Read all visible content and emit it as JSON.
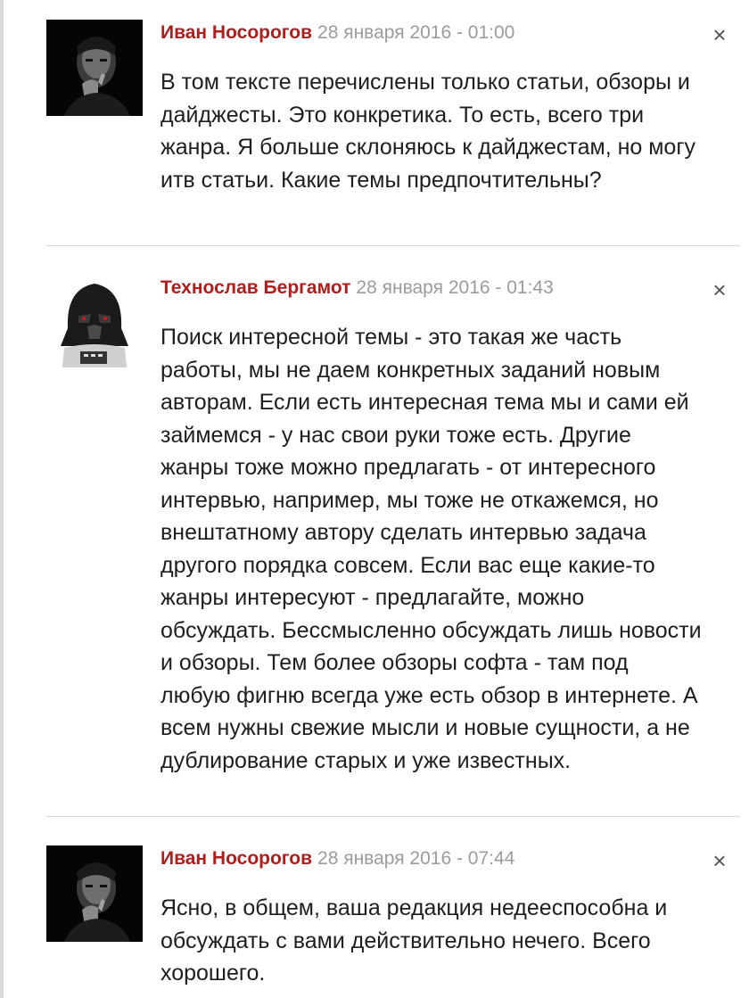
{
  "comments": [
    {
      "author": "Иван Носорогов",
      "date": "28 января 2016 - 01:00",
      "avatar_icon": "man-portrait-avatar",
      "text": "В том тексте перечислены только статьи, обзоры и дайджесты. Это конкретика. То есть, всего три жанра. Я больше склоняюсь к дайджестам, но могу итв статьи. Какие темы предпочтительны?",
      "close_icon": "×"
    },
    {
      "author": "Технослав Бергамот",
      "date": "28 января 2016 - 01:43",
      "avatar_icon": "darth-vader-avatar",
      "text": "Поиск интересной темы - это такая же часть работы, мы не даем конкретных заданий новым авторам. Если есть интересная тема мы и сами ей займемся - у нас свои руки тоже есть. Другие жанры тоже можно предлагать - от интересного интервью, например, мы тоже не откажемся, но внештатному автору сделать интервью задача другого порядка совсем. Если вас еще какие-то жанры интересуют - предлагайте, можно обсуждать. Бессмысленно обсуждать лишь новости и обзоры. Тем более обзоры софта - там под любую фигню всегда уже есть обзор в интернете. А всем нужны свежие мысли и новые сущности, а не дублирование старых и уже известных.",
      "close_icon": "×"
    },
    {
      "author": "Иван Носорогов",
      "date": "28 января 2016 - 07:44",
      "avatar_icon": "man-portrait-avatar",
      "text": "Ясно, в общем, ваша редакция недееспособна и обсуждать с вами действительно нечего. Всего хорошего.",
      "close_icon": "×"
    }
  ],
  "colors": {
    "author": "#b01d1d",
    "date": "#9b9b9b",
    "divider": "#d8d8d8"
  }
}
